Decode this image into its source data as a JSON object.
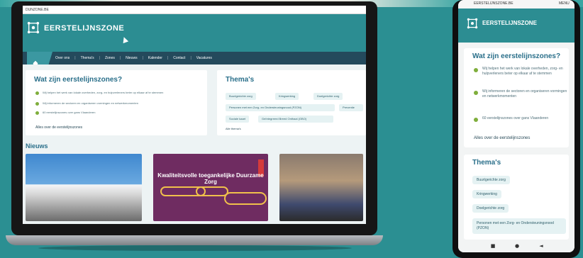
{
  "laptop": {
    "address": "DUNZONE.BE",
    "brand": "EERSTELIJNSZONE",
    "nav_items": [
      "Over ons",
      "Thema's",
      "Zones",
      "Nieuws",
      "Kalender",
      "Contact",
      "Vacatures"
    ],
    "left_card": {
      "title": "Wat zijn eerstelijnszones?",
      "bullets": [
        "Wij helpen het werk van lokale overheden, zorg- en hulpverleners beter op elkaar af te stemmen",
        "Wij informeren de sectoren en organiseren vormingen en netwerkmomenten",
        "60 eerstelijnszones over gans Vlaanderen"
      ],
      "link": "Alles over de eerstelijnszones"
    },
    "right_card": {
      "title": "Thema's",
      "tags": [
        "Buurtgerichte zorg",
        "Kringwerking",
        "Doelgerichte zorg",
        "Personen met een Zorg- en Ondersteuningsnood (PZON)",
        "Preventie",
        "Sociale kaart",
        "Geïntegreerd Breed Onthaal (GBO)"
      ],
      "link": "Alle thema's"
    },
    "news": {
      "title": "Nieuws",
      "banner_text": "Kwaliteitsvolle toegankelijke Duurzame Zorg"
    }
  },
  "phone": {
    "url": "EERSTELIJNSZONE.BE",
    "menu": "MENU",
    "brand": "EERSTELIJNSZONE",
    "card1": {
      "title": "Wat zijn eerstelijnszones?",
      "bullets": [
        "Wij helpen het werk van lokale overheden, zorg- en hulpverleners beter op elkaar af te stemmen",
        "Wij informeren de sectoren en organiseren vormingen en netwerkmomenten",
        "60 eerstelijnszones over gans Vlaanderen"
      ],
      "link": "Alles over de eerstelijnszones"
    },
    "card2": {
      "title": "Thema's",
      "tags": [
        "Buurtgerichte zorg",
        "Kringwerking",
        "Doelgerichte zorg",
        "Personen met een Zorg- en Ondersteuningsnood (PZON)"
      ]
    },
    "nav": {
      "square": "■",
      "home": "●",
      "back": "◄"
    }
  },
  "colors": {
    "teal": "#2c8d92",
    "navy": "#244a5c",
    "accent_green": "#7fae3b",
    "heading": "#2a6f8a"
  }
}
